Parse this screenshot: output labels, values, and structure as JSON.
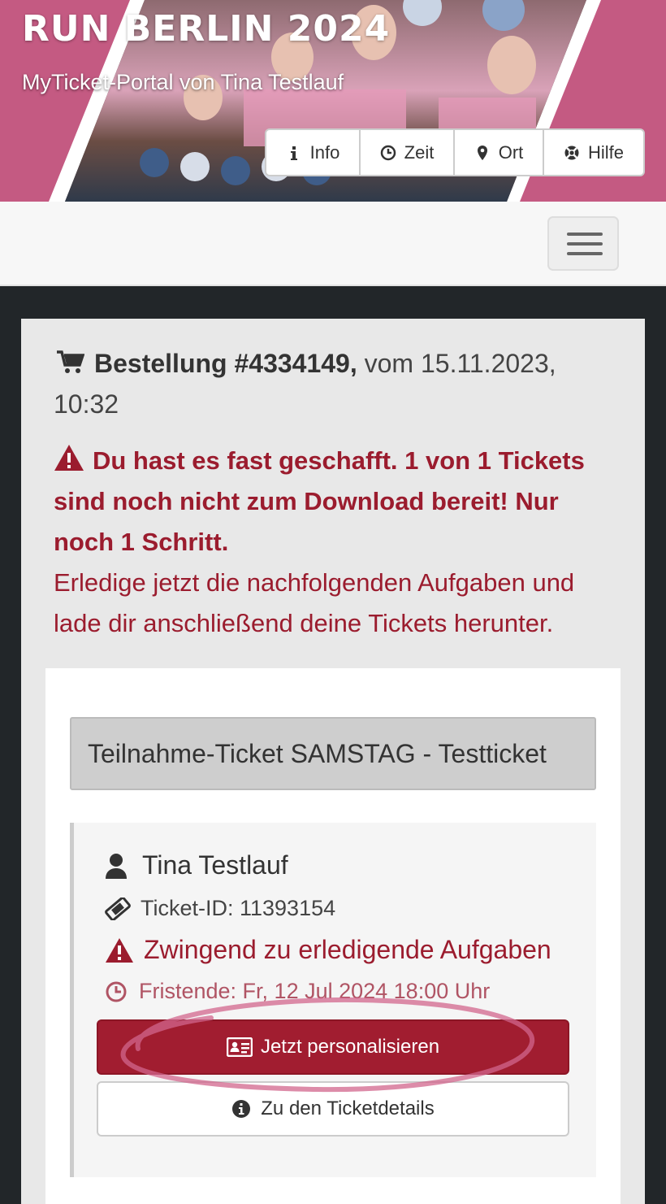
{
  "header": {
    "title": "RUN BERLIN 2024",
    "subtitle": "MyTicket-Portal von Tina Testlauf",
    "nav": [
      {
        "label": "Info",
        "icon": "info-icon"
      },
      {
        "label": "Zeit",
        "icon": "clock-icon"
      },
      {
        "label": "Ort",
        "icon": "map-marker-icon"
      },
      {
        "label": "Hilfe",
        "icon": "life-ring-icon"
      }
    ]
  },
  "navbar": {
    "toggle_icon": "hamburger-icon"
  },
  "order": {
    "prefix": "Bestellung #4334149,",
    "date": " vom 15.11.2023, 10:32",
    "icon": "shopping-cart-icon"
  },
  "alert": {
    "bold_text": "Du hast es fast geschafft. 1 von 1 Tickets sind noch nicht zum Download bereit! Nur noch 1 Schritt.",
    "text": "Erledige jetzt die nachfolgenden Aufgaben und lade dir anschließend deine Tickets herunter.",
    "icon": "warning-icon"
  },
  "ticket": {
    "title": "Teilnahme-Ticket SAMSTAG - Testticket",
    "holder": "Tina Testlauf",
    "ticket_id": "Ticket-ID: 11393154",
    "todo": "Zwingend zu erledigende Aufgaben",
    "deadline": "Fristende: Fr, 12 Jul 2024 18:00 Uhr",
    "personalize_label": "Jetzt personalisieren",
    "details_label": "Zu den Ticketdetails"
  },
  "colors": {
    "brand": "#c45a82",
    "danger": "#a11d30",
    "page_bg": "#222629"
  }
}
